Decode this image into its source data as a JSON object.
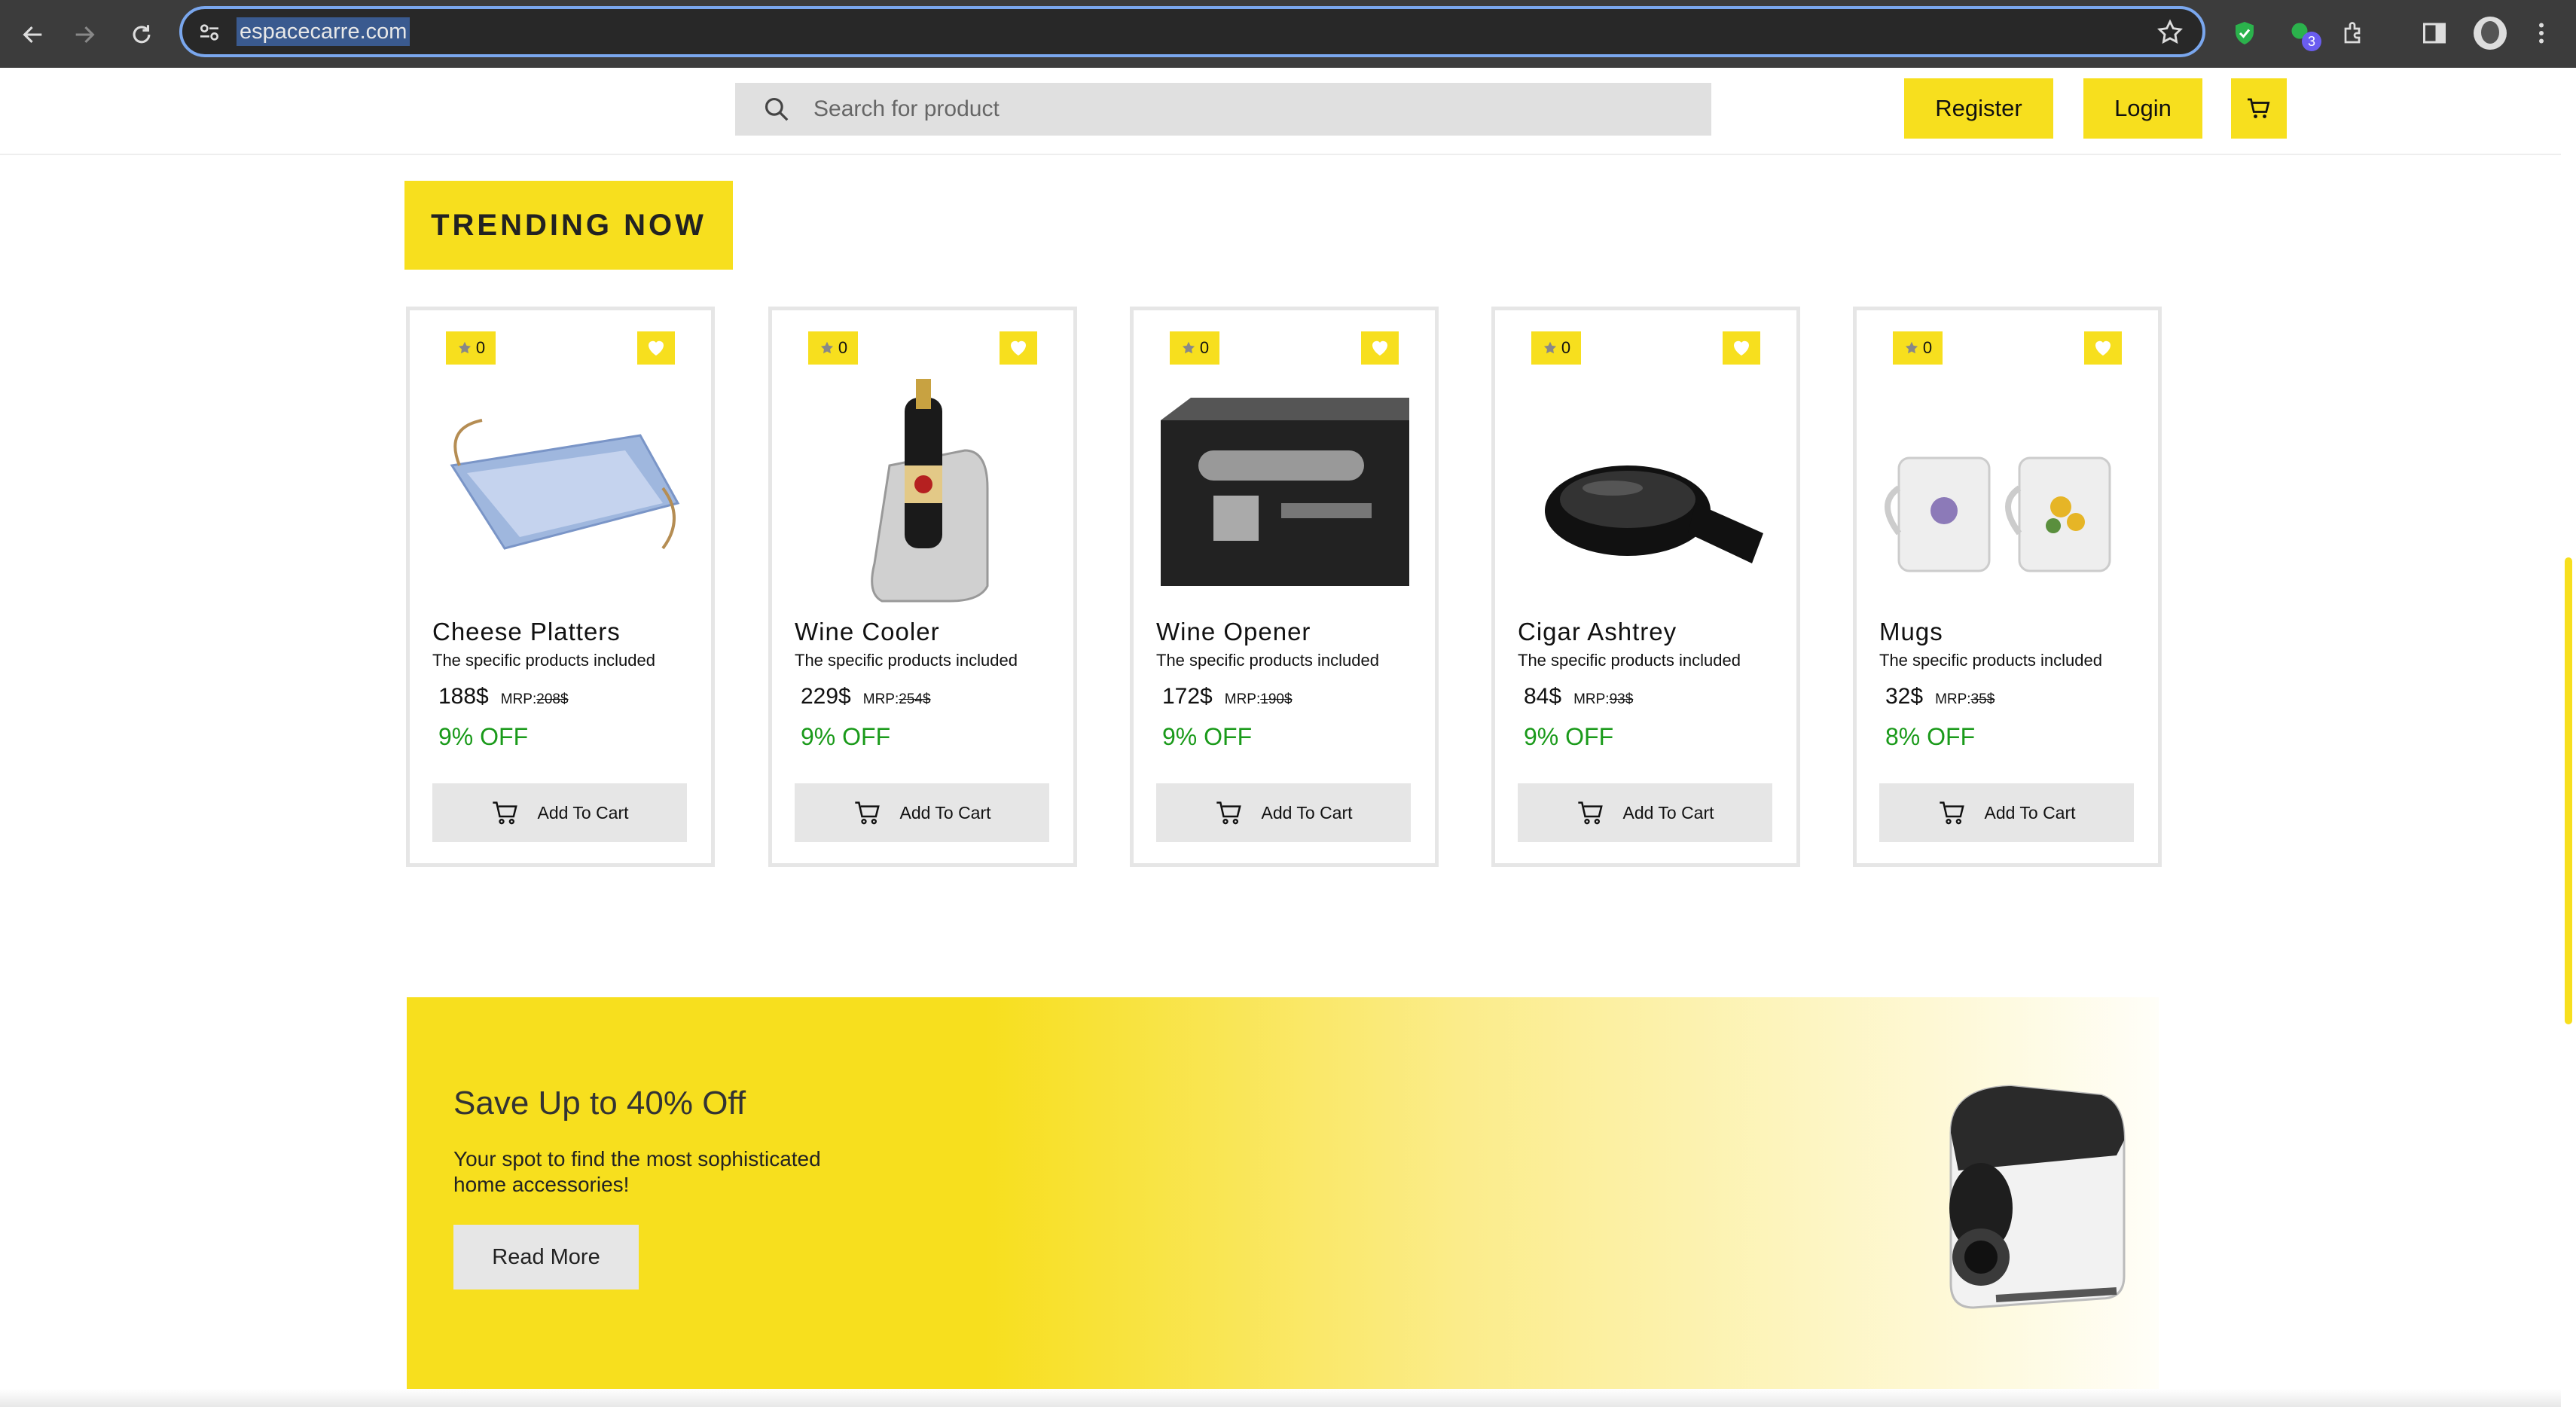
{
  "browser": {
    "url": "espacecarre.com",
    "extension_badge": "3"
  },
  "header": {
    "search_placeholder": "Search for product",
    "register_label": "Register",
    "login_label": "Login"
  },
  "trending": {
    "title": "TRENDING NOW",
    "products": [
      {
        "name": "Cheese Platters",
        "desc": "The specific products included",
        "price": "188$",
        "mrp_label": "MRP:",
        "mrp": "208$",
        "off": "9% OFF",
        "rating": "0",
        "cart_label": "Add To Cart",
        "image_icon": "bag-platter"
      },
      {
        "name": "Wine Cooler",
        "desc": "The specific products included",
        "price": "229$",
        "mrp_label": "MRP:",
        "mrp": "254$",
        "off": "9% OFF",
        "rating": "0",
        "cart_label": "Add To Cart",
        "image_icon": "wine-cooler"
      },
      {
        "name": "Wine Opener",
        "desc": "The specific products included",
        "price": "172$",
        "mrp_label": "MRP:",
        "mrp": "190$",
        "off": "9% OFF",
        "rating": "0",
        "cart_label": "Add To Cart",
        "image_icon": "opener-case"
      },
      {
        "name": "Cigar Ashtrey",
        "desc": "The specific products included",
        "price": "84$",
        "mrp_label": "MRP:",
        "mrp": "93$",
        "off": "9% OFF",
        "rating": "0",
        "cart_label": "Add To Cart",
        "image_icon": "ashtray"
      },
      {
        "name": "Mugs",
        "desc": "The specific products included",
        "price": "32$",
        "mrp_label": "MRP:",
        "mrp": "35$",
        "off": "8% OFF",
        "rating": "0",
        "cart_label": "Add To Cart",
        "image_icon": "mugs"
      }
    ]
  },
  "banner": {
    "title": "Save Up to 40% Off",
    "text": "Your spot to find the most sophisticated home accessories!",
    "button_label": "Read More"
  },
  "colors": {
    "accent": "#f7df1e",
    "discount": "#1a9a1a",
    "card_border": "#e6e6e6"
  }
}
